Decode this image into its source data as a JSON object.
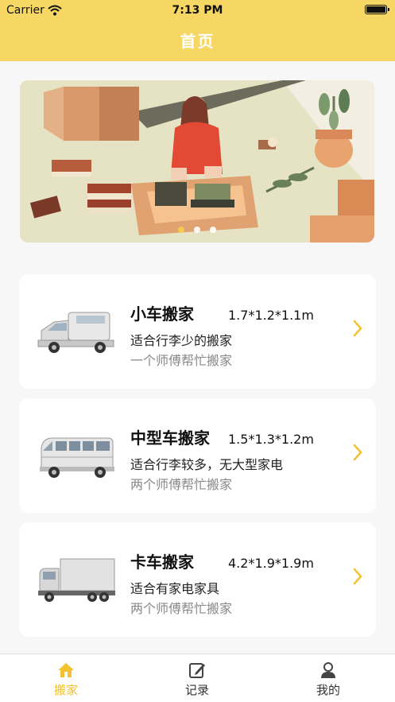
{
  "status_bar": {
    "carrier": "Carrier",
    "time": "7:13 PM"
  },
  "header": {
    "title": "首页"
  },
  "banner": {
    "dots": 3,
    "active_index": 0
  },
  "services": [
    {
      "title": "小车搬家",
      "dimensions": "1.7*1.2*1.1m",
      "description": "适合行李少的搬家",
      "helpers": "一个师傅帮忙搬家",
      "vehicle_icon": "small-van-icon"
    },
    {
      "title": "中型车搬家",
      "dimensions": "1.5*1.3*1.2m",
      "description": "适合行李较多，无大型家电",
      "helpers": "两个师傅帮忙搬家",
      "vehicle_icon": "minibus-icon"
    },
    {
      "title": "卡车搬家",
      "dimensions": "4.2*1.9*1.9m",
      "description": "适合有家电家具",
      "helpers": "两个师傅帮忙搬家",
      "vehicle_icon": "truck-icon"
    }
  ],
  "tabs": [
    {
      "label": "搬家",
      "icon": "home-icon",
      "active": true
    },
    {
      "label": "记录",
      "icon": "edit-record-icon",
      "active": false
    },
    {
      "label": "我的",
      "icon": "user-icon",
      "active": false
    }
  ],
  "colors": {
    "accent": "#f7d764",
    "active_tab": "#f2c230",
    "chevron": "#f2c230"
  }
}
